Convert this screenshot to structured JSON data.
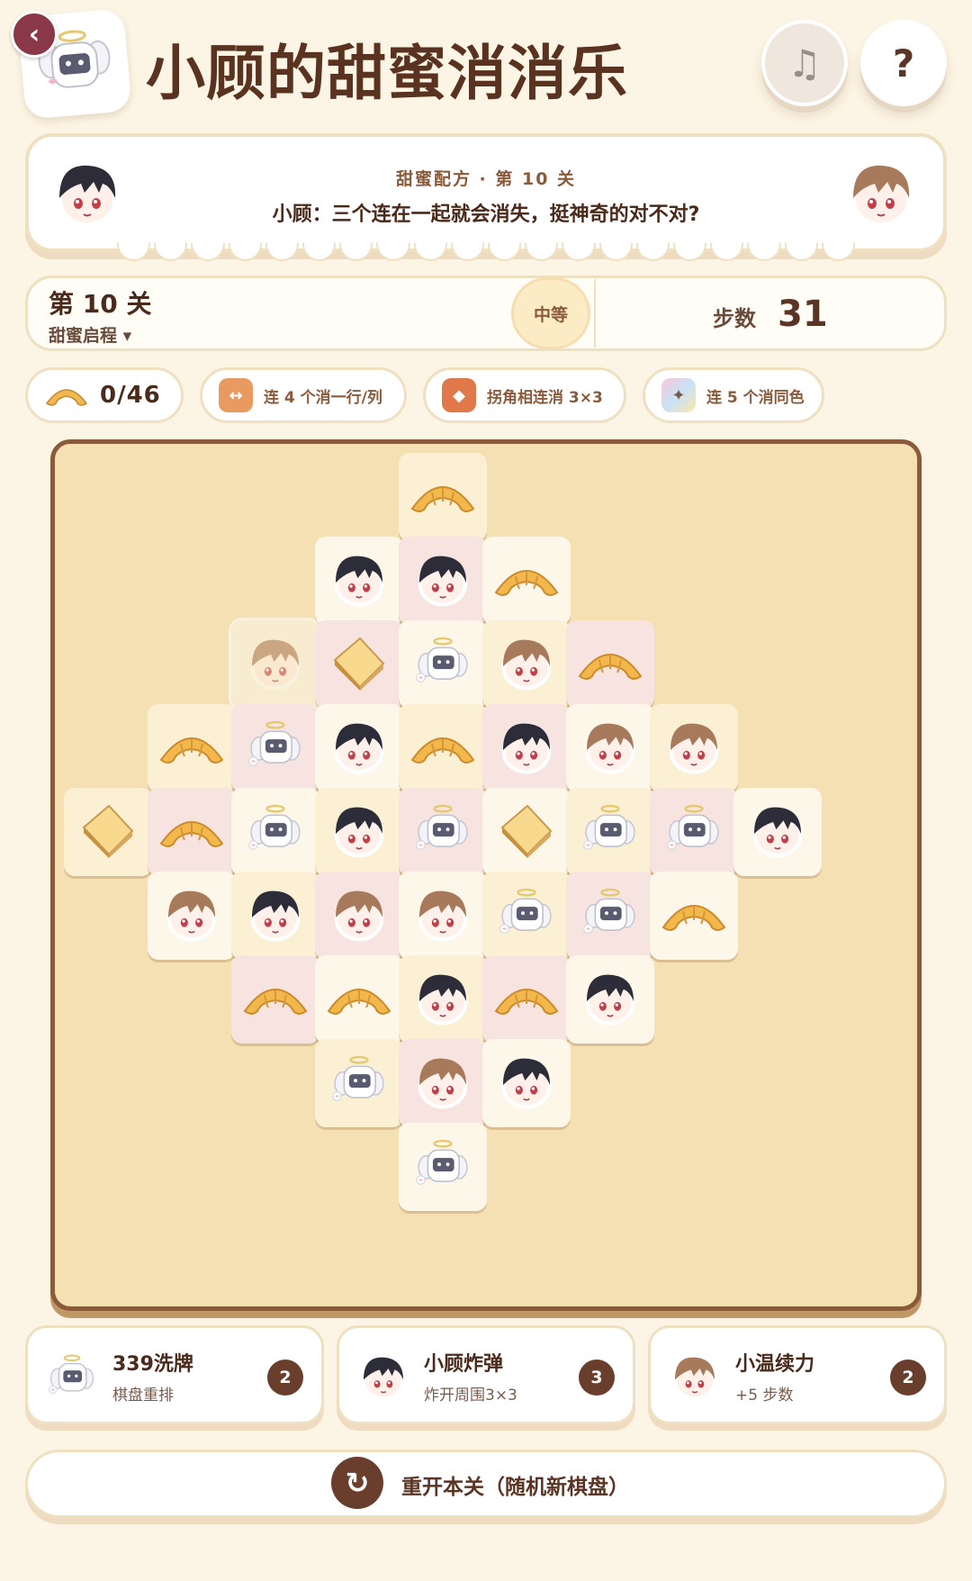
{
  "header": {
    "back_icon": "chevron-left-icon",
    "title": "小顾的甜蜜消消乐",
    "music_icon": "music-note-icon",
    "help_label": "?"
  },
  "dialog": {
    "subtitle": "甜蜜配方 · 第 10 关",
    "text": "小顾：三个连在一起就会消失，挺神奇的对不对?"
  },
  "level": {
    "title": "第 10 关",
    "chapter": "甜蜜启程 ▾",
    "difficulty": "中等",
    "steps_label": "步数",
    "steps_value": "31"
  },
  "chips": {
    "goal_icon": "croissant-icon",
    "goal_count": "0/46",
    "rule1": "连 4 个消一行/列",
    "rule2": "拐角相连消 3×3",
    "rule3": "连 5 个消同色"
  },
  "board": {
    "tiles": [
      {
        "r": 0,
        "c": 4,
        "type": "croissant",
        "bg": "yellow"
      },
      {
        "r": 1,
        "c": 3,
        "type": "dark-hair",
        "bg": "cream"
      },
      {
        "r": 1,
        "c": 4,
        "type": "dark-hair",
        "bg": "pink"
      },
      {
        "r": 1,
        "c": 5,
        "type": "croissant",
        "bg": "cream"
      },
      {
        "r": 2,
        "c": 2,
        "type": "brown-hair",
        "bg": "cream",
        "faded": true
      },
      {
        "r": 2,
        "c": 3,
        "type": "toast",
        "bg": "pink"
      },
      {
        "r": 2,
        "c": 4,
        "type": "robot",
        "bg": "cream"
      },
      {
        "r": 2,
        "c": 5,
        "type": "brown-hair",
        "bg": "yellow"
      },
      {
        "r": 2,
        "c": 6,
        "type": "croissant",
        "bg": "pink"
      },
      {
        "r": 3,
        "c": 1,
        "type": "croissant",
        "bg": "yellow"
      },
      {
        "r": 3,
        "c": 2,
        "type": "robot",
        "bg": "pink"
      },
      {
        "r": 3,
        "c": 3,
        "type": "dark-hair",
        "bg": "cream"
      },
      {
        "r": 3,
        "c": 4,
        "type": "croissant",
        "bg": "yellow"
      },
      {
        "r": 3,
        "c": 5,
        "type": "dark-hair",
        "bg": "pink"
      },
      {
        "r": 3,
        "c": 6,
        "type": "brown-hair",
        "bg": "cream"
      },
      {
        "r": 3,
        "c": 7,
        "type": "brown-hair",
        "bg": "yellow"
      },
      {
        "r": 4,
        "c": 0,
        "type": "toast",
        "bg": "yellow"
      },
      {
        "r": 4,
        "c": 1,
        "type": "croissant",
        "bg": "pink"
      },
      {
        "r": 4,
        "c": 2,
        "type": "robot",
        "bg": "cream"
      },
      {
        "r": 4,
        "c": 3,
        "type": "dark-hair",
        "bg": "yellow"
      },
      {
        "r": 4,
        "c": 4,
        "type": "robot",
        "bg": "pink"
      },
      {
        "r": 4,
        "c": 5,
        "type": "toast",
        "bg": "cream"
      },
      {
        "r": 4,
        "c": 6,
        "type": "robot",
        "bg": "yellow"
      },
      {
        "r": 4,
        "c": 7,
        "type": "robot",
        "bg": "pink"
      },
      {
        "r": 4,
        "c": 8,
        "type": "dark-hair",
        "bg": "cream"
      },
      {
        "r": 5,
        "c": 1,
        "type": "brown-hair",
        "bg": "cream"
      },
      {
        "r": 5,
        "c": 2,
        "type": "dark-hair",
        "bg": "yellow"
      },
      {
        "r": 5,
        "c": 3,
        "type": "brown-hair",
        "bg": "pink"
      },
      {
        "r": 5,
        "c": 4,
        "type": "brown-hair",
        "bg": "cream"
      },
      {
        "r": 5,
        "c": 5,
        "type": "robot",
        "bg": "yellow"
      },
      {
        "r": 5,
        "c": 6,
        "type": "robot",
        "bg": "pink"
      },
      {
        "r": 5,
        "c": 7,
        "type": "croissant",
        "bg": "cream"
      },
      {
        "r": 6,
        "c": 2,
        "type": "croissant",
        "bg": "pink"
      },
      {
        "r": 6,
        "c": 3,
        "type": "croissant",
        "bg": "cream"
      },
      {
        "r": 6,
        "c": 4,
        "type": "dark-hair",
        "bg": "yellow"
      },
      {
        "r": 6,
        "c": 5,
        "type": "croissant",
        "bg": "pink"
      },
      {
        "r": 6,
        "c": 6,
        "type": "dark-hair",
        "bg": "cream"
      },
      {
        "r": 7,
        "c": 3,
        "type": "robot",
        "bg": "yellow"
      },
      {
        "r": 7,
        "c": 4,
        "type": "brown-hair",
        "bg": "pink"
      },
      {
        "r": 7,
        "c": 5,
        "type": "dark-hair",
        "bg": "cream"
      },
      {
        "r": 8,
        "c": 4,
        "type": "robot",
        "bg": "cream"
      }
    ]
  },
  "items": [
    {
      "name": "339洗牌",
      "desc": "棋盘重排",
      "count": "2",
      "icon": "robot"
    },
    {
      "name": "小顾炸弹",
      "desc": "炸开周围3×3",
      "count": "3",
      "icon": "dark-hair"
    },
    {
      "name": "小温续力",
      "desc": "+5 步数",
      "count": "2",
      "icon": "brown-hair"
    }
  ],
  "restart": {
    "icon": "refresh-icon",
    "label": "重开本关（随机新棋盘）"
  },
  "colors": {
    "background": "#fcf4e4",
    "board": "#f4e0b2",
    "board_border": "#8a5a3a",
    "accent": "#6a3e2c",
    "back_button": "#8a3848"
  }
}
